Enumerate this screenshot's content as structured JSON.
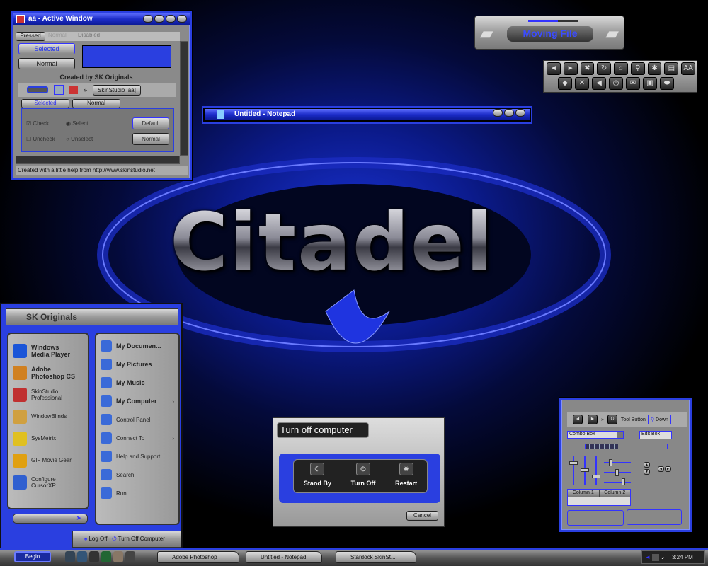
{
  "logo": {
    "text": "Citadel"
  },
  "active_window": {
    "title": "aa - Active Window",
    "tabs": [
      "Pressed",
      "Normal",
      "Disabled"
    ],
    "list_buttons": [
      "Selected",
      "Normal"
    ],
    "caption": "Created by SK Originals",
    "toolbar_button": "SkinStudio [aa]",
    "chevron": "»",
    "inner_tabs": [
      "Selected",
      "Normal"
    ],
    "check_label": "Check",
    "uncheck_label": "Uncheck",
    "select_label": "Select",
    "unselect_label": "Unselect",
    "default_button": "Default",
    "normal_button": "Normal",
    "status": "Created with a little help from http://www.skinstudio.net"
  },
  "moving_file": {
    "label": "Moving File",
    "progress": 0.6
  },
  "toolbar_icons": {
    "row1": [
      "back",
      "forward",
      "stop",
      "refresh",
      "home",
      "search",
      "favorites",
      "print",
      "font-size"
    ],
    "row1_glyphs": [
      "◄",
      "►",
      "✖",
      "↻",
      "⌂",
      "⚲",
      "✱",
      "▤",
      "AA"
    ],
    "row2": [
      "folder",
      "tools",
      "volume",
      "history",
      "mail",
      "edit",
      "discuss"
    ],
    "row2_glyphs": [
      "◆",
      "✕",
      "◀",
      "◷",
      "✉",
      "▣",
      "⬬"
    ]
  },
  "notepad": {
    "title": "Untitled - Notepad"
  },
  "start_menu": {
    "user": "SK Originals",
    "left_pinned": [
      {
        "l1": "Windows",
        "l2": "Media Player",
        "color": "#1a55d8"
      },
      {
        "l1": "Adobe",
        "l2": "Photoshop CS",
        "color": "#d08020"
      }
    ],
    "left_recent": [
      {
        "l1": "SkinStudio",
        "l2": "Professional",
        "color": "#c03030"
      },
      {
        "l1": "WindowBlinds",
        "l2": "",
        "color": "#d0a040"
      },
      {
        "l1": "SysMetrix",
        "l2": "",
        "color": "#e0c020"
      },
      {
        "l1": "GIF Movie Gear",
        "l2": "",
        "color": "#e0a010"
      },
      {
        "l1": "Configure",
        "l2": "CursorXP",
        "color": "#3060d0"
      }
    ],
    "right_items": [
      {
        "label": "My Documen...",
        "bold": true,
        "arrow": ""
      },
      {
        "label": "My Pictures",
        "bold": true,
        "arrow": ""
      },
      {
        "label": "My Music",
        "bold": true,
        "arrow": ""
      },
      {
        "label": "My Computer",
        "bold": true,
        "arrow": "›"
      },
      {
        "label": "Control Panel",
        "bold": false,
        "arrow": ""
      },
      {
        "label": "Connect To",
        "bold": false,
        "arrow": "›"
      },
      {
        "label": "Help and Support",
        "bold": false,
        "arrow": ""
      },
      {
        "label": "Search",
        "bold": false,
        "arrow": ""
      },
      {
        "label": "Run...",
        "bold": false,
        "arrow": ""
      }
    ],
    "log_off": "Log Off",
    "turn_off": "Turn Off Computer"
  },
  "turn_off_dialog": {
    "title": "Turn off computer",
    "options": [
      {
        "label": "Stand By",
        "glyph": "☾"
      },
      {
        "label": "Turn Off",
        "glyph": "⏻"
      },
      {
        "label": "Restart",
        "glyph": "✹"
      }
    ],
    "cancel": "Cancel"
  },
  "controls_window": {
    "tool_button": "Tool Button",
    "down": "Down",
    "combo": "Combo Box",
    "edit": "Edit Box",
    "columns": [
      "Column 1",
      "Column 2"
    ],
    "progress": 0.4
  },
  "taskbar": {
    "start": "Begin",
    "tasks": [
      "Adobe Photoshop",
      "Untitled - Notepad",
      "Stardock SkinSt..."
    ],
    "clock": "3:24 PM"
  },
  "colors": {
    "accent": "#2a3fe0",
    "metal": "#a0a0a0"
  }
}
